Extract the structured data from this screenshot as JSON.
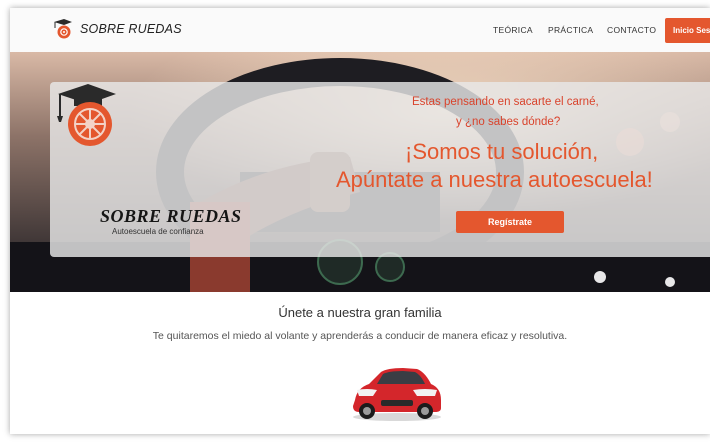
{
  "nav": {
    "brand": "SOBRE RUEDAS",
    "links": [
      "TEÓRICA",
      "PRÁCTICA",
      "CONTACTO"
    ],
    "login_label": "Inicio Sesión"
  },
  "hero": {
    "question_line1": "Estas pensando en sacarte el carné,",
    "question_line2": "y ¿no sabes dónde?",
    "headline_line1": "¡Somos tu solución,",
    "headline_line2": "Apúntate a nuestra autoescuela!",
    "register_label": "Regístrate",
    "logo_brand": "SOBRE RUEDAS",
    "logo_tagline": "Autoescuela de confianza"
  },
  "intro": {
    "title": "Únete a nuestra gran familia",
    "text": "Te quitaremos el miedo al volante y aprenderás a conducir de manera eficaz y resolutiva."
  },
  "colors": {
    "accent": "#e4572e",
    "text_red": "#d9432c"
  },
  "icons": {
    "logo": "graduation-cap-wheel-icon",
    "car": "red-car-image"
  }
}
